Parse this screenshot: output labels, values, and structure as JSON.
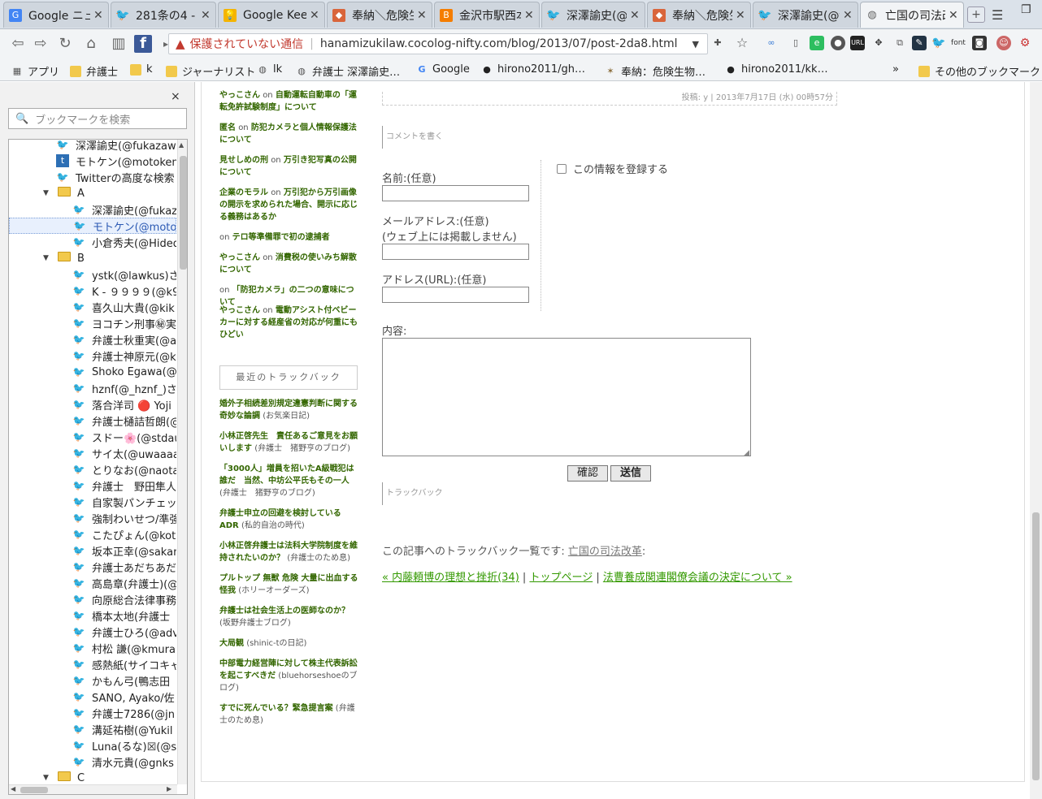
{
  "tabs": [
    {
      "title": "Google ニュー",
      "icon": "google-news-icon",
      "active": false
    },
    {
      "title": "281条の4 - T",
      "icon": "twitter-icon",
      "active": false
    },
    {
      "title": "Google Keep",
      "icon": "google-keep-icon",
      "active": false
    },
    {
      "title": "奉納＼危険生",
      "icon": "bookmark-app-icon",
      "active": false
    },
    {
      "title": "金沢市駅西本",
      "icon": "blogger-icon",
      "active": false
    },
    {
      "title": "深澤諭史(@f",
      "icon": "twitter-icon",
      "active": false
    },
    {
      "title": "奉納＼危険生",
      "icon": "bookmark-app-icon",
      "active": false
    },
    {
      "title": "深澤諭史(@f",
      "icon": "twitter-icon",
      "active": false
    },
    {
      "title": "亡国の司法改",
      "icon": "globe-icon",
      "active": true
    }
  ],
  "omnibox": {
    "security_label": "保護されていない通信",
    "url": "hanamizukilaw.cocolog-nifty.com/blog/2013/07/post-2da8.html"
  },
  "bookmarks_bar": {
    "items": [
      "アプリ",
      "弁護士",
      "k",
      "ジャーナリスト",
      "lk",
      "弁護士 深澤諭史…",
      "Google",
      "hirono2011/gh…",
      "奉納：危険生物…",
      "hirono2011/kk…"
    ],
    "overflow": "»",
    "other": "その他のブックマーク"
  },
  "sidebar": {
    "close": "×",
    "search_placeholder": "ブックマークを検索",
    "tree": [
      {
        "label": "深澤諭史(@fukazawa",
        "type": "twitter",
        "indent": 1
      },
      {
        "label": "モトケン(@motoken_",
        "type": "blog",
        "indent": 1
      },
      {
        "label": "Twitterの高度な検索",
        "type": "twitter",
        "indent": 1
      },
      {
        "label": "A",
        "type": "folder",
        "indent": 0
      },
      {
        "label": "深澤諭史(@fukaz",
        "type": "twitter",
        "indent": 2
      },
      {
        "label": "モトケン(@motok",
        "type": "twitter",
        "indent": 2,
        "selected": true
      },
      {
        "label": "小倉秀夫(@Hided",
        "type": "twitter",
        "indent": 2
      },
      {
        "label": "B",
        "type": "folder",
        "indent": 0
      },
      {
        "label": "ystk(@lawkus)さ",
        "type": "twitter",
        "indent": 2
      },
      {
        "label": "K - ９９９９(@k99",
        "type": "twitter",
        "indent": 2
      },
      {
        "label": "喜久山大貴(@kik",
        "type": "twitter",
        "indent": 2
      },
      {
        "label": "ヨコチン刑事㊙実",
        "type": "twitter",
        "indent": 2
      },
      {
        "label": "弁護士秋重実(@a",
        "type": "twitter",
        "indent": 2
      },
      {
        "label": "弁護士神原元(@k",
        "type": "twitter",
        "indent": 2
      },
      {
        "label": "Shoko Egawa(@",
        "type": "twitter",
        "indent": 2
      },
      {
        "label": "hznf(@_hznf_)さ",
        "type": "twitter",
        "indent": 2
      },
      {
        "label": "落合洋司 🔴 Yoji",
        "type": "twitter",
        "indent": 2
      },
      {
        "label": "弁護士樋詰哲朗(@",
        "type": "twitter",
        "indent": 2
      },
      {
        "label": "スドー🌸(@stdau",
        "type": "twitter",
        "indent": 2
      },
      {
        "label": "サイ太(@uwaaaa)",
        "type": "twitter-red",
        "indent": 2
      },
      {
        "label": "とりなお(@naotar",
        "type": "twitter",
        "indent": 2
      },
      {
        "label": "弁護士　野田隼人",
        "type": "twitter",
        "indent": 2
      },
      {
        "label": "自家製パンチェッタ",
        "type": "twitter",
        "indent": 2
      },
      {
        "label": "強制わいせつ/準強",
        "type": "twitter",
        "indent": 2
      },
      {
        "label": "こたぴょん(@kotac",
        "type": "twitter-red",
        "indent": 2
      },
      {
        "label": "坂本正幸(@sakan",
        "type": "twitter",
        "indent": 2
      },
      {
        "label": "弁護士あだちあだ",
        "type": "twitter",
        "indent": 2
      },
      {
        "label": "高島章(弁護士)(@",
        "type": "twitter",
        "indent": 2
      },
      {
        "label": "向原総合法律事務",
        "type": "twitter",
        "indent": 2
      },
      {
        "label": "橋本太地(弁護士",
        "type": "twitter",
        "indent": 2
      },
      {
        "label": "弁護士ひろ(@adv",
        "type": "twitter",
        "indent": 2
      },
      {
        "label": "村松 謙(@kmuran",
        "type": "twitter",
        "indent": 2
      },
      {
        "label": "感熱紙(サイコキャ",
        "type": "twitter",
        "indent": 2
      },
      {
        "label": "かもん弓(鴨志田",
        "type": "twitter",
        "indent": 2
      },
      {
        "label": "SANO, Ayako/佐",
        "type": "twitter",
        "indent": 2
      },
      {
        "label": "弁護士7286(@jn",
        "type": "twitter",
        "indent": 2
      },
      {
        "label": "溝延祐樹(@Yukil",
        "type": "twitter",
        "indent": 2
      },
      {
        "label": "Luna(るな)☒(@s",
        "type": "twitter",
        "indent": 2
      },
      {
        "label": "清水元貴(@gnks",
        "type": "twitter-red",
        "indent": 2
      },
      {
        "label": "C",
        "type": "folder",
        "indent": 0
      }
    ]
  },
  "page": {
    "recent_comments": [
      {
        "author": "やっこさん",
        "on": "on",
        "title": "自動運転自動車の「運転免許試験制度」について"
      },
      {
        "author": "匿名",
        "on": "on",
        "title": "防犯カメラと個人情報保護法について"
      },
      {
        "author": "見せしめの刑",
        "on": "on",
        "title": "万引き犯写真の公開について"
      },
      {
        "author": "企業のモラル",
        "on": "on",
        "title": "万引犯から万引画像の開示を求められた場合、開示に応じる義務はあるか"
      },
      {
        "author": "",
        "on": "on",
        "title": "テロ等準備罪で初の逮捕者"
      },
      {
        "author": "やっこさん",
        "on": "on",
        "title": "消費税の使いみち解散について"
      },
      {
        "author": "",
        "on": "on",
        "title": "「防犯カメラ」の二つの意味について"
      },
      {
        "author": "やっこさん",
        "on": "on",
        "title": "電動アシスト付ベビーカーに対する経産省の対応が何重にもひどい"
      }
    ],
    "trackback_box": "最近のトラックバック",
    "recent_trackbacks": [
      {
        "title": "婚外子相続差別規定違憲判断に関する奇妙な論調",
        "source": "(お気楽日記)"
      },
      {
        "title": "小林正啓先生　責任あるご意見をお願いします",
        "source": "(弁護士　猪野亨のブログ)"
      },
      {
        "title": "「3000人」増員を招いたA級戦犯は誰だ　当然、中坊公平氏もその一人",
        "source": "(弁護士　猪野亨のブログ)"
      },
      {
        "title": "弁護士申立の回避を検討しているADR",
        "source": "(私的自治の時代)"
      },
      {
        "title": "小林正啓弁護士は法科大学院制度を維持されたいのか？",
        "source": "(弁護士のため息)"
      },
      {
        "title": "プルトップ 無獣 危険 大量に出血する怪我",
        "source": "(ホリーオーダーズ)"
      },
      {
        "title": "弁護士は社会生活上の医師なのか？",
        "source": "(坂野弁護士ブログ)"
      },
      {
        "title": "大局観",
        "source": "(shinic-tの日記)"
      },
      {
        "title": "中部電力経営陣に対して株主代表訴訟を起こすべきだ",
        "source": "(bluehorseshoeのブログ)"
      },
      {
        "title": "すでに死んでいる？緊急提言案",
        "source": "(弁護士のため息)"
      }
    ],
    "post_meta": "投稿: y | 2013年7月17日 (水) 00時57分",
    "comment_heading": "コメントを書く",
    "form": {
      "name_label": "名前:(任意)",
      "email_label": "メールアドレス:(任意)",
      "email_note": "(ウェブ上には掲載しません)",
      "url_label": "アドレス(URL):(任意)",
      "remember_label": "この情報を登録する",
      "body_label": "内容:",
      "confirm_button": "確認",
      "submit_button": "送信"
    },
    "trackback_heading": "トラックバック",
    "trackback_list_prefix": "この記事へのトラックバック一覧です:",
    "trackback_list_link": "亡国の司法改革",
    "trackback_list_suffix": ":",
    "nav": {
      "prev": "« 内藤頼博の理想と挫折(34)",
      "sep1": "|",
      "top": "トップページ",
      "sep2": "|",
      "next": "法曹養成関連閣僚会議の決定について »"
    }
  }
}
